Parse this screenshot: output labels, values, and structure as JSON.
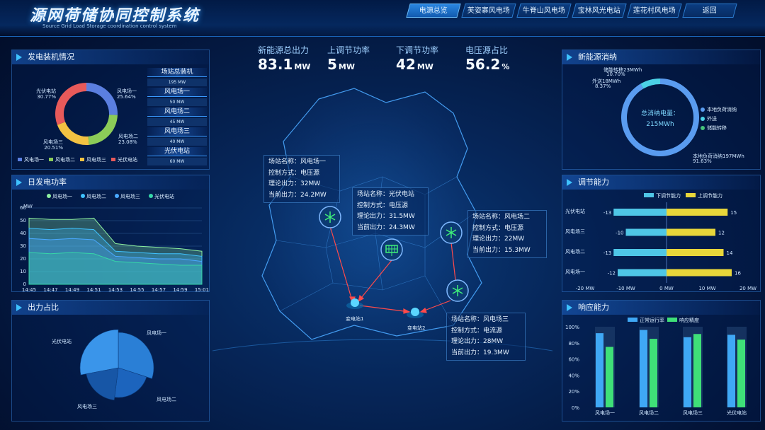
{
  "header": {
    "title": "源网荷储协同控制系统",
    "subtitle": "Source Grid Load Storage coordination control system",
    "nav": [
      {
        "label": "电源总览",
        "active": true
      },
      {
        "label": "芙姿寨风电场"
      },
      {
        "label": "牛脊山风电场"
      },
      {
        "label": "宝林风光电站"
      },
      {
        "label": "莲花村风电场"
      },
      {
        "label": "返回"
      }
    ]
  },
  "kpis": [
    {
      "label": "新能源总出力",
      "value": "83.1",
      "unit": "MW"
    },
    {
      "label": "上调节功率",
      "value": "5",
      "unit": "MW"
    },
    {
      "label": "下调节功率",
      "value": "42",
      "unit": "MW"
    },
    {
      "label": "电压源占比",
      "value": "56.2",
      "unit": "%"
    }
  ],
  "panels": {
    "gen": "发电装机情况",
    "daily": "日发电功率",
    "output": "出力占比",
    "consume": "新能源消纳",
    "adjust": "调节能力",
    "response": "响应能力"
  },
  "gen_chart": {
    "type": "pie",
    "slices": [
      {
        "name": "风电场一",
        "value": 25.64,
        "color": "#5b7fe0",
        "label": "风电场一\n25.64%"
      },
      {
        "name": "风电场二",
        "value": 23.08,
        "color": "#8ccc58",
        "label": "风电场二\n23.08%"
      },
      {
        "name": "风电场三",
        "value": 20.51,
        "color": "#f3c242",
        "label": "风电场三\n20.51%"
      },
      {
        "name": "光伏电站",
        "value": 30.77,
        "color": "#e75a5a",
        "label": "光伏电站\n30.77%"
      }
    ]
  },
  "gen_list": [
    {
      "label": "场站总装机",
      "value": "195 MW"
    },
    {
      "label": "风电场一",
      "value": "50 MW"
    },
    {
      "label": "风电场二",
      "value": "45 MW"
    },
    {
      "label": "风电场三",
      "value": "40 MW"
    },
    {
      "label": "光伏电站",
      "value": "60 MW"
    }
  ],
  "daily_chart": {
    "type": "area",
    "legend": [
      "风电场一",
      "风电场二",
      "风电场三",
      "光伏电站"
    ],
    "colors": [
      "#8ef0a0",
      "#3fc3ff",
      "#4aa9ff",
      "#36d6a8"
    ],
    "ylabel": "MW",
    "ylim": [
      0,
      60
    ],
    "yticks": [
      0,
      10,
      20,
      30,
      40,
      50,
      60
    ],
    "x": [
      "14:45",
      "14:47",
      "14:49",
      "14:51",
      "14:53",
      "14:55",
      "14:57",
      "14:59",
      "15:01"
    ],
    "series": [
      {
        "name": "风电场一",
        "values": [
          52,
          51,
          51,
          52,
          32,
          30,
          29,
          28,
          26
        ]
      },
      {
        "name": "风电场二",
        "values": [
          44,
          43,
          44,
          43,
          26,
          25,
          24,
          24,
          22
        ]
      },
      {
        "name": "风电场三",
        "values": [
          36,
          35,
          36,
          35,
          22,
          21,
          20,
          20,
          18
        ]
      },
      {
        "name": "光伏电站",
        "values": [
          25,
          24,
          25,
          24,
          18,
          17,
          16,
          15,
          15
        ]
      }
    ]
  },
  "output_chart": {
    "type": "pie",
    "slices": [
      {
        "name": "风电场一",
        "value": 30,
        "color": "#2a7fd6"
      },
      {
        "name": "风电场二",
        "value": 22,
        "color": "#1c64bd"
      },
      {
        "name": "风电场三",
        "value": 20,
        "color": "#1756a6"
      },
      {
        "name": "光伏电站",
        "value": 28,
        "color": "#3a95ea"
      }
    ]
  },
  "consume_chart": {
    "type": "pie",
    "center_label": "总消纳电量：",
    "center_value": "215MWh",
    "slices": [
      {
        "name": "本地负荷消纳",
        "value": 197,
        "pct": "91.63%",
        "color": "#5a9cf0"
      },
      {
        "name": "外送",
        "value": 18,
        "pct": "8.37%",
        "color": "#4cd2e6"
      },
      {
        "name": "储能转移",
        "value": 23,
        "pct": "10.70%",
        "color": "#46c37a"
      }
    ],
    "labels": [
      "储能转移23MWh",
      "10.70%",
      "外送18MWh",
      "8.37%",
      "本地负荷消纳197MWh",
      "91.63%"
    ]
  },
  "adjust_chart": {
    "type": "bar",
    "legend": [
      "下调节能力",
      "上调节能力"
    ],
    "colors": [
      "#4fc6e6",
      "#e8d63a"
    ],
    "categories": [
      "光伏电站",
      "风电场三",
      "风电场二",
      "风电场一"
    ],
    "down": [
      -13,
      -10,
      -13,
      -12
    ],
    "up": [
      15,
      12,
      14,
      16
    ],
    "xlim": [
      -20,
      20
    ],
    "xticks": [
      "-20 MW",
      "-10 MW",
      "0 MW",
      "10 MW",
      "20 MW"
    ]
  },
  "response_chart": {
    "type": "bar",
    "legend": [
      "正常运行率",
      "响应精度"
    ],
    "colors": [
      "#3fa8f5",
      "#3fe078"
    ],
    "categories": [
      "风电场一",
      "风电场二",
      "风电场三",
      "光伏电站"
    ],
    "series": [
      {
        "name": "正常运行率",
        "values": [
          92,
          96,
          87,
          90
        ]
      },
      {
        "name": "响应精度",
        "values": [
          75,
          85,
          91,
          84
        ]
      }
    ],
    "ylim": [
      0,
      100
    ],
    "yticks": [
      "0%",
      "20%",
      "40%",
      "60%",
      "80%",
      "100%"
    ]
  },
  "map": {
    "stations": [
      {
        "name": "风电场一",
        "mode": "电压源",
        "theory": "32MW",
        "current": "24.2MW"
      },
      {
        "name": "光伏电站",
        "mode": "电压源",
        "theory": "31.5MW",
        "current": "24.3MW"
      },
      {
        "name": "风电场二",
        "mode": "电压源",
        "theory": "22MW",
        "current": "15.3MW"
      },
      {
        "name": "风电场三",
        "mode": "电流源",
        "theory": "28MW",
        "current": "19.3MW"
      }
    ],
    "field_labels": [
      "场站名称：",
      "控制方式：",
      "理论出力：",
      "当前出力："
    ],
    "substations": [
      "变电站1",
      "变电站2"
    ]
  }
}
